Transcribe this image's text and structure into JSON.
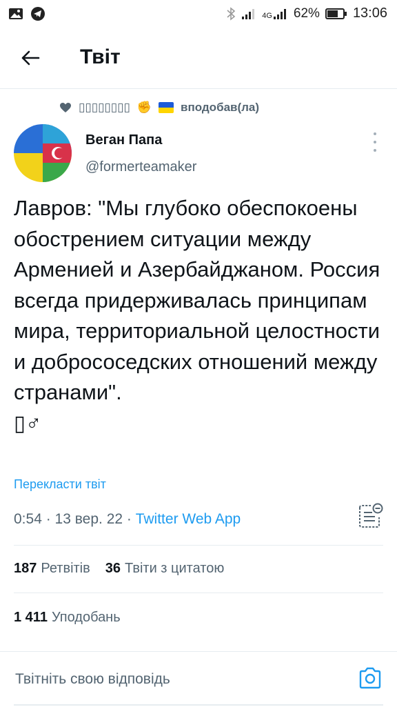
{
  "status_bar": {
    "network": "4G",
    "battery": "62%",
    "time": "13:06"
  },
  "header": {
    "title": "Твіт"
  },
  "social_context": {
    "liker_name": "▯▯▯▯▯▯▯▯",
    "action": "вподобав(ла)"
  },
  "tweet": {
    "author_name": "Веган Папа",
    "author_handle": "@formerteamaker",
    "text": "Лавров: \"Мы глубоко обеспокоены обострением ситуации между Арменией и Азербайджаном. Россия всегда придерживалась принципам мира, территориальной целостности и добрососедских отношений между странами\".\n▯♂",
    "translate_label": "Перекласти твіт",
    "time": "0:54",
    "date": "13 вер. 22",
    "source": "Twitter Web App"
  },
  "stats": {
    "retweets_count": "187",
    "retweets_label": "Ретвітів",
    "quotes_count": "36",
    "quotes_label": "Твіти з цитатою",
    "likes_count": "1 411",
    "likes_label": "Уподобань"
  },
  "reply": {
    "placeholder": "Твітніть свою відповідь"
  }
}
